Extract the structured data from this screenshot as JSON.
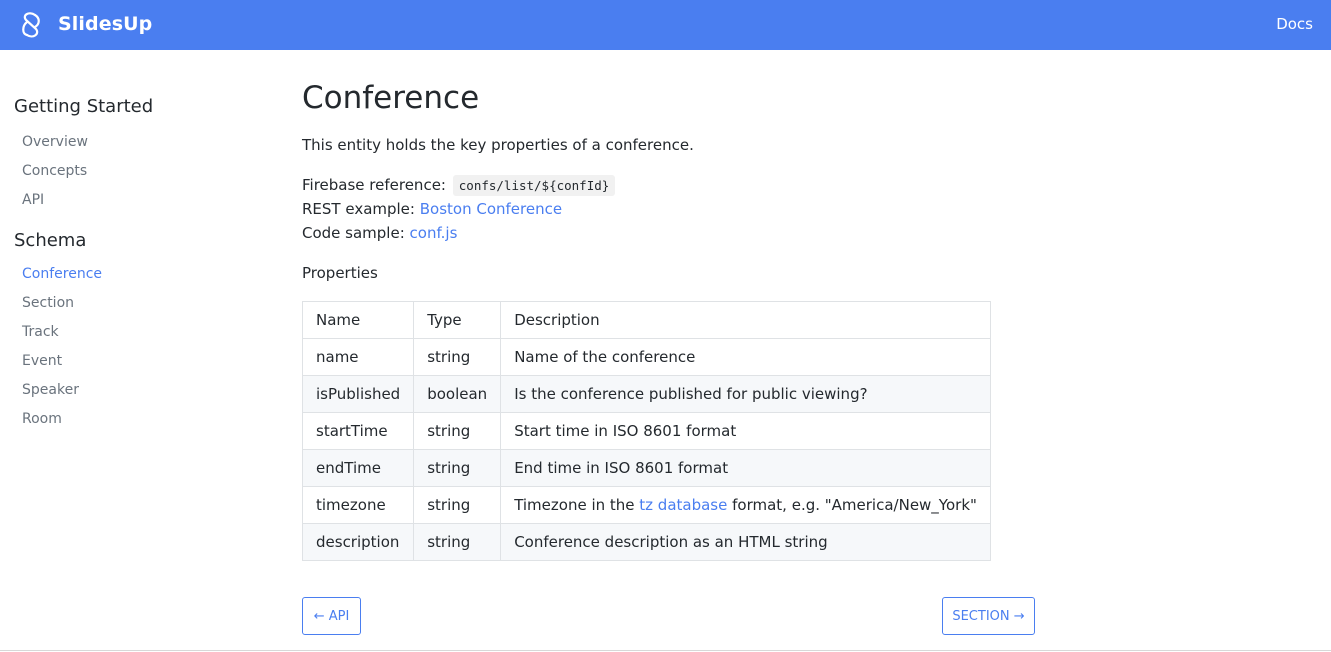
{
  "header": {
    "brand": "SlidesUp",
    "docs_link": "Docs"
  },
  "sidebar": {
    "groups": [
      {
        "heading": "Getting Started",
        "items": [
          "Overview",
          "Concepts",
          "API"
        ]
      },
      {
        "heading": "Schema",
        "items": [
          "Conference",
          "Section",
          "Track",
          "Event",
          "Speaker",
          "Room"
        ]
      }
    ],
    "active_item": "Conference"
  },
  "page": {
    "title": "Conference",
    "intro": "This entity holds the key properties of a conference.",
    "firebase_label": "Firebase reference:",
    "firebase_ref": "confs/list/${confId}",
    "rest_label": "REST example:",
    "rest_link": "Boston Conference",
    "code_label": "Code sample:",
    "code_link": "conf.js",
    "properties_label": "Properties"
  },
  "table": {
    "headers": [
      "Name",
      "Type",
      "Description"
    ],
    "rows": [
      {
        "name": "name",
        "type": "string",
        "description": "Name of the conference"
      },
      {
        "name": "isPublished",
        "type": "boolean",
        "description": "Is the conference published for public viewing?"
      },
      {
        "name": "startTime",
        "type": "string",
        "description": "Start time in ISO 8601 format"
      },
      {
        "name": "endTime",
        "type": "string",
        "description": "End time in ISO 8601 format"
      },
      {
        "name": "timezone",
        "type": "string",
        "description_prefix": "Timezone in the ",
        "description_link": "tz database",
        "description_suffix": " format, e.g. \"America/New_York\""
      },
      {
        "name": "description",
        "type": "string",
        "description": "Conference description as an HTML string"
      }
    ]
  },
  "pager": {
    "prev": "← API",
    "next": "SECTION →"
  },
  "colors": {
    "accent": "#4a7ef0",
    "text": "#24292e",
    "muted": "#6a737d",
    "row_alt": "#f6f8fa",
    "border": "#dfe2e5"
  },
  "icons": {
    "logo": "slidesup-logo-icon"
  }
}
